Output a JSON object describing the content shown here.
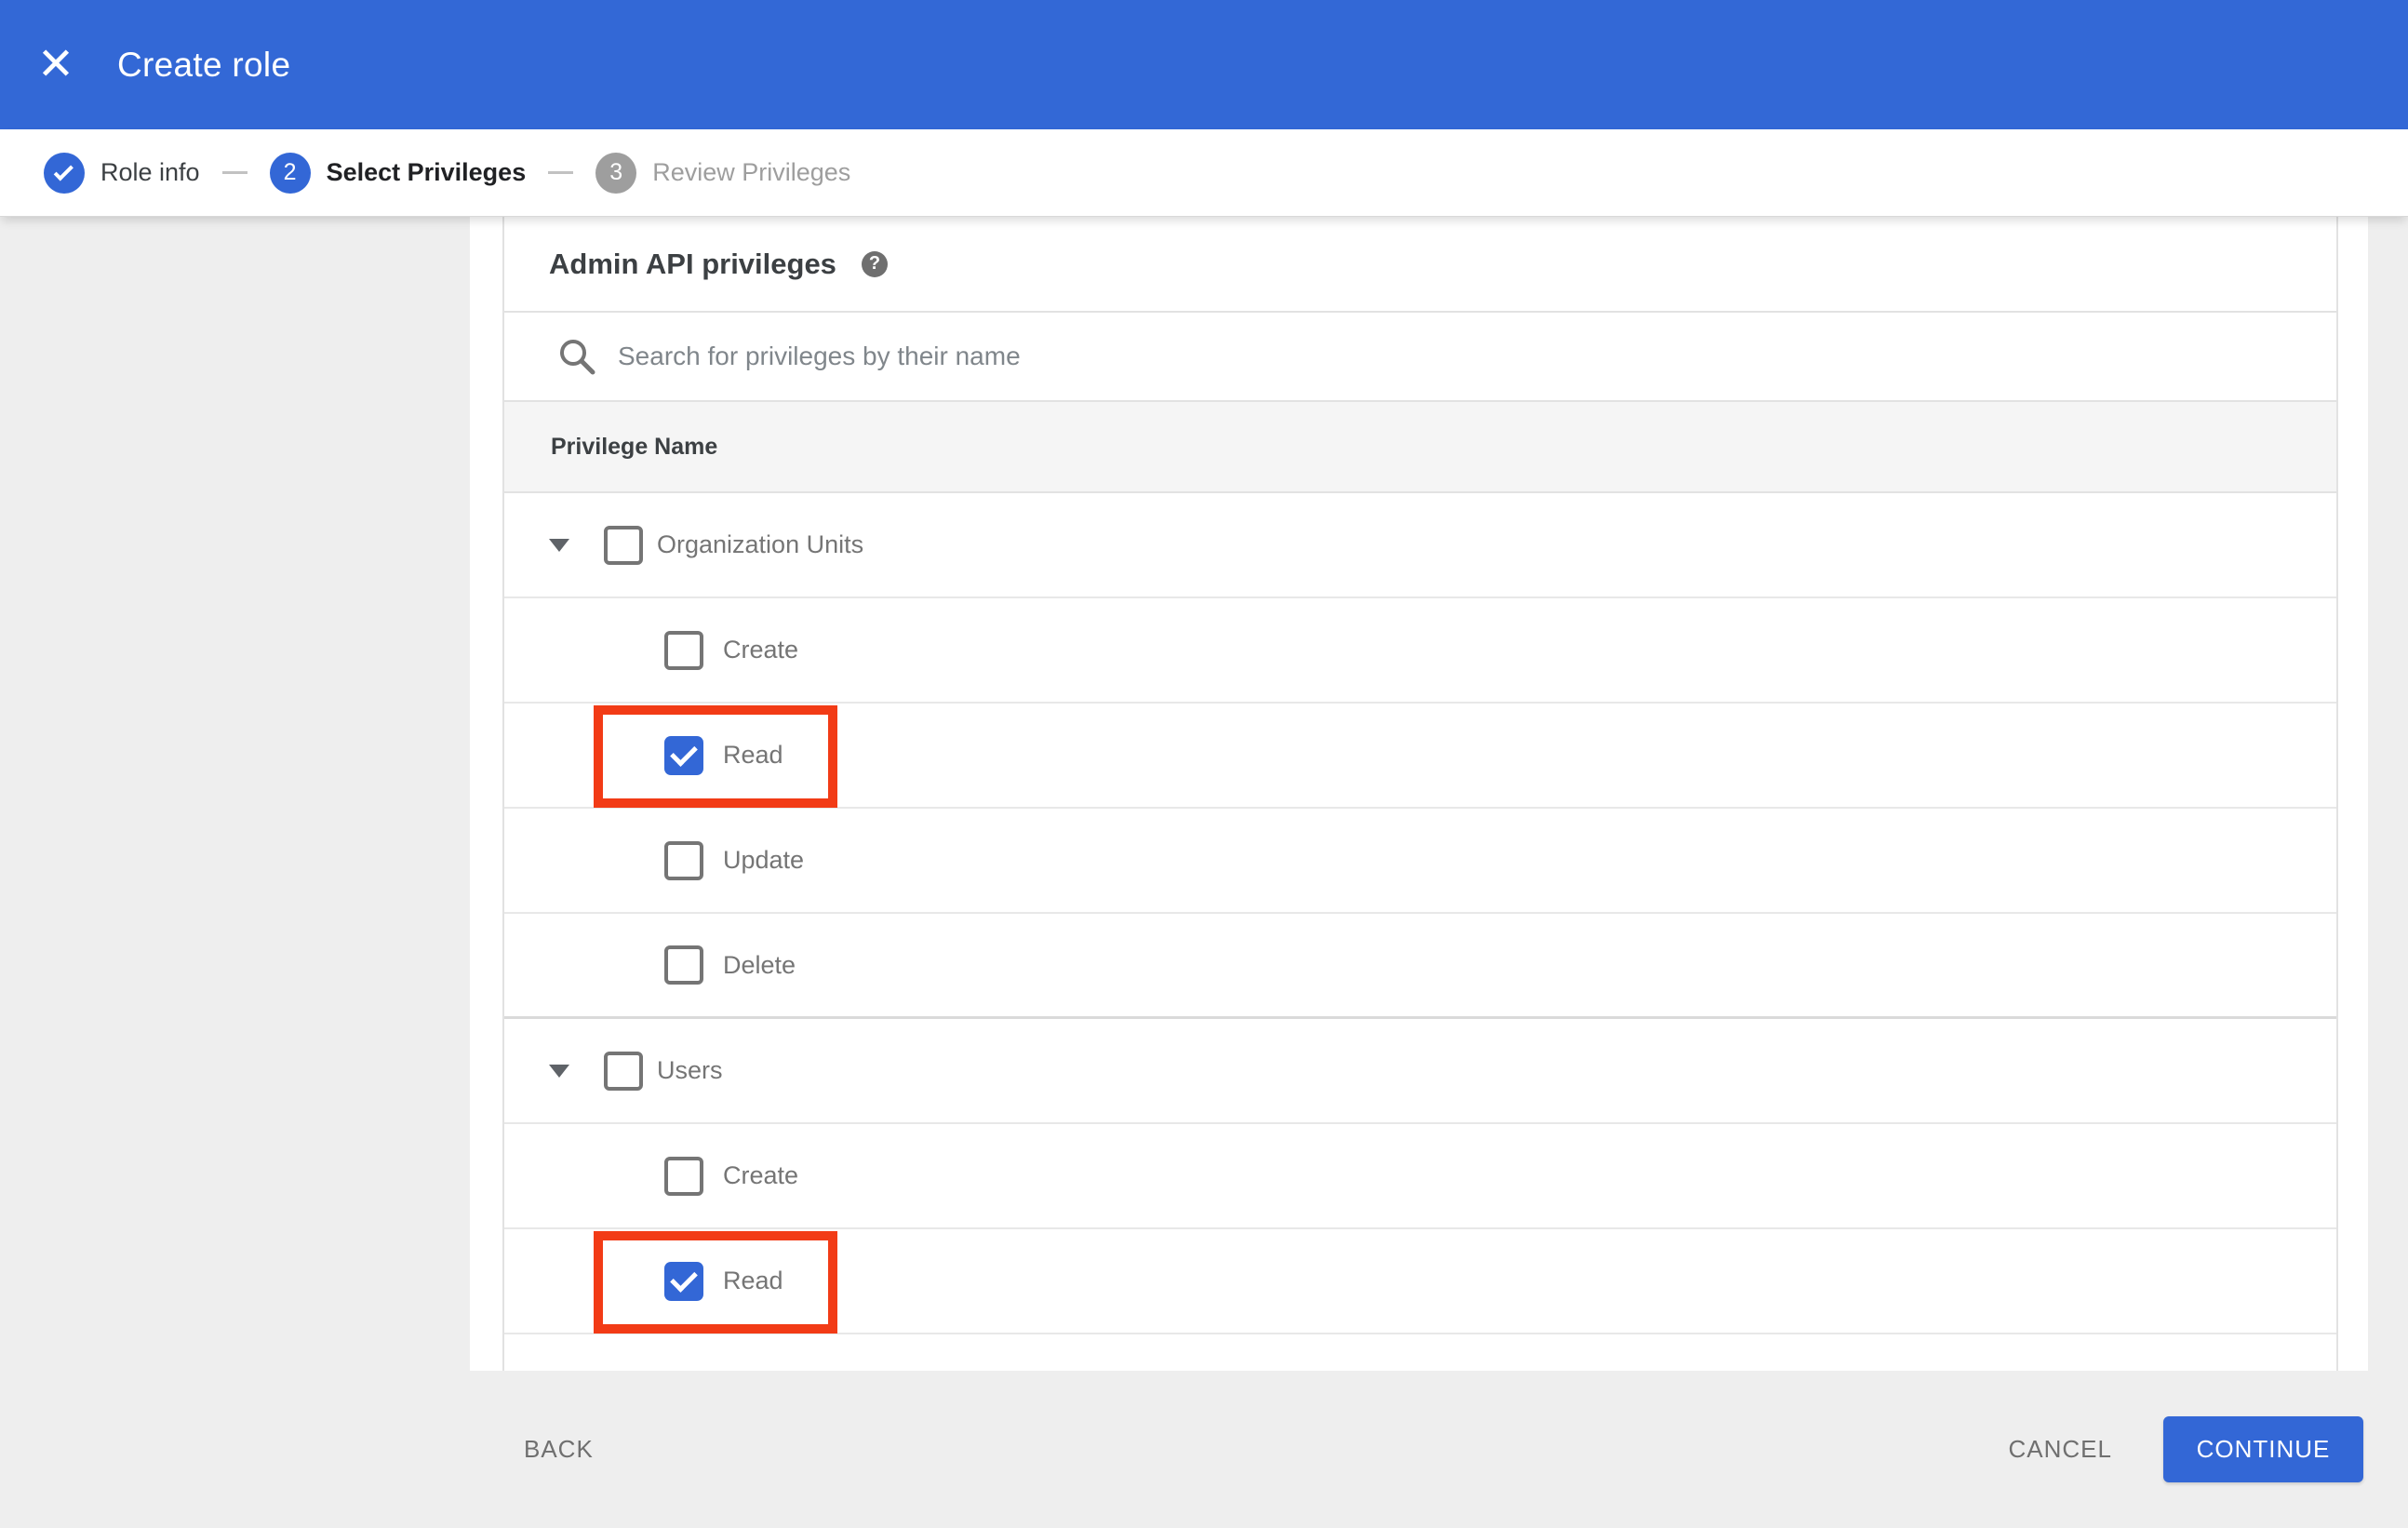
{
  "appbar": {
    "title": "Create role"
  },
  "stepper": {
    "steps": [
      {
        "number": "",
        "label": "Role info",
        "state": "completed"
      },
      {
        "number": "2",
        "label": "Select Privileges",
        "state": "active"
      },
      {
        "number": "3",
        "label": "Review Privileges",
        "state": "upcoming"
      }
    ]
  },
  "content": {
    "section_title": "Admin API privileges",
    "search": {
      "placeholder": "Search for privileges by their name"
    },
    "table": {
      "header": "Privilege Name",
      "groups": [
        {
          "label": "Organization Units",
          "checked": false,
          "children": [
            {
              "label": "Create",
              "checked": false,
              "highlighted": false
            },
            {
              "label": "Read",
              "checked": true,
              "highlighted": true
            },
            {
              "label": "Update",
              "checked": false,
              "highlighted": false
            },
            {
              "label": "Delete",
              "checked": false,
              "highlighted": false
            }
          ]
        },
        {
          "label": "Users",
          "checked": false,
          "children": [
            {
              "label": "Create",
              "checked": false,
              "highlighted": false
            },
            {
              "label": "Read",
              "checked": true,
              "highlighted": true
            }
          ]
        }
      ]
    }
  },
  "footer": {
    "back": "BACK",
    "cancel": "CANCEL",
    "continue": "CONTINUE"
  },
  "icons": {
    "close": "close-icon",
    "help": "help-icon",
    "search": "search-icon",
    "expand": "chevron-down-icon",
    "step_check": "check-icon"
  },
  "colors": {
    "appbar_blue": "#3368d6",
    "accent_blue": "#3367d6",
    "highlight_red": "#f23b16",
    "step_inactive_gray": "#9e9e9e",
    "page_gray": "#eeeeee",
    "row_border": "#e8e8e8",
    "label_gray": "#757575"
  }
}
